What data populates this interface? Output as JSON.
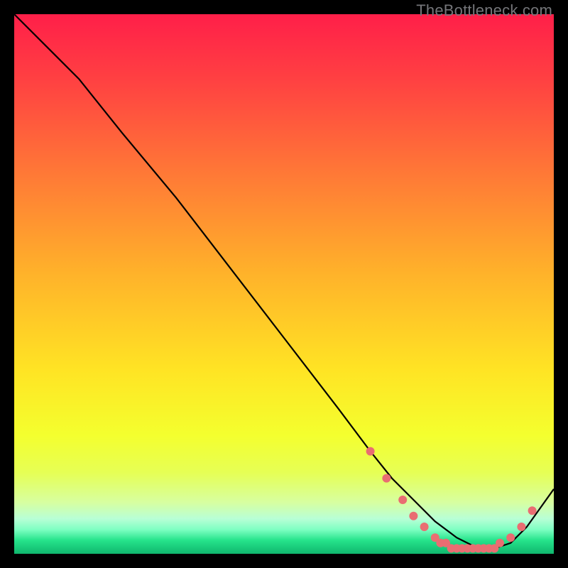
{
  "watermark": "TheBottleneck.com",
  "chart_data": {
    "type": "line",
    "title": "",
    "xlabel": "",
    "ylabel": "",
    "xlim": [
      0,
      100
    ],
    "ylim": [
      0,
      100
    ],
    "grid": false,
    "legend": false,
    "background_gradient": {
      "type": "vertical",
      "stops": [
        {
          "pos": 0.0,
          "color": "#ff1f49"
        },
        {
          "pos": 0.12,
          "color": "#ff4042"
        },
        {
          "pos": 0.3,
          "color": "#ff7a36"
        },
        {
          "pos": 0.48,
          "color": "#ffb22a"
        },
        {
          "pos": 0.66,
          "color": "#ffe424"
        },
        {
          "pos": 0.78,
          "color": "#f4ff2e"
        },
        {
          "pos": 0.85,
          "color": "#e6ff55"
        },
        {
          "pos": 0.905,
          "color": "#d7ffa1"
        },
        {
          "pos": 0.935,
          "color": "#b8ffd6"
        },
        {
          "pos": 0.955,
          "color": "#7effc2"
        },
        {
          "pos": 0.975,
          "color": "#26e38b"
        },
        {
          "pos": 1.0,
          "color": "#0fb76d"
        }
      ]
    },
    "series": [
      {
        "name": "curve",
        "stroke": "#000000",
        "x": [
          0,
          7,
          12,
          20,
          30,
          40,
          50,
          60,
          66,
          70,
          74,
          78,
          82,
          86,
          89,
          92,
          95,
          100
        ],
        "y": [
          100,
          93,
          88,
          78,
          66,
          53,
          40,
          27,
          19,
          14,
          10,
          6,
          3,
          1,
          1,
          2,
          5,
          12
        ]
      }
    ],
    "markers": {
      "name": "dots",
      "color": "#e96d72",
      "radius": 6,
      "points": [
        {
          "x": 66,
          "y": 19
        },
        {
          "x": 69,
          "y": 14
        },
        {
          "x": 72,
          "y": 10
        },
        {
          "x": 74,
          "y": 7
        },
        {
          "x": 76,
          "y": 5
        },
        {
          "x": 78,
          "y": 3
        },
        {
          "x": 79,
          "y": 2
        },
        {
          "x": 80,
          "y": 2
        },
        {
          "x": 81,
          "y": 1
        },
        {
          "x": 82,
          "y": 1
        },
        {
          "x": 83,
          "y": 1
        },
        {
          "x": 84,
          "y": 1
        },
        {
          "x": 85,
          "y": 1
        },
        {
          "x": 86,
          "y": 1
        },
        {
          "x": 87,
          "y": 1
        },
        {
          "x": 88,
          "y": 1
        },
        {
          "x": 89,
          "y": 1
        },
        {
          "x": 90,
          "y": 2
        },
        {
          "x": 92,
          "y": 3
        },
        {
          "x": 94,
          "y": 5
        },
        {
          "x": 96,
          "y": 8
        }
      ]
    }
  }
}
